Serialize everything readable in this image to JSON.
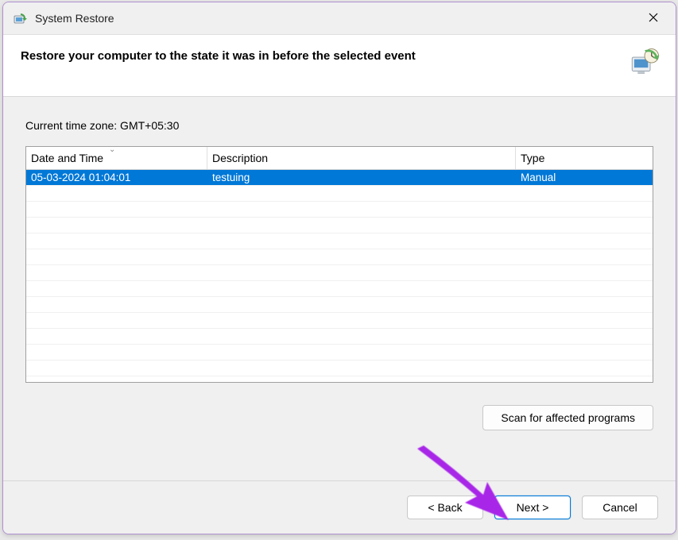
{
  "window": {
    "title": "System Restore"
  },
  "header": {
    "heading": "Restore your computer to the state it was in before the selected event"
  },
  "content": {
    "timezone_label": "Current time zone: GMT+05:30",
    "columns": {
      "date": "Date and Time",
      "desc": "Description",
      "type": "Type"
    },
    "rows": [
      {
        "date": "05-03-2024 01:04:01",
        "desc": "testuing",
        "type": "Manual",
        "selected": true
      }
    ],
    "scan_button": "Scan for affected programs"
  },
  "footer": {
    "back": "< Back",
    "next": "Next >",
    "cancel": "Cancel"
  },
  "colors": {
    "selection": "#0078d7",
    "accent_border": "#0078d7",
    "arrow": "#a826e8"
  }
}
